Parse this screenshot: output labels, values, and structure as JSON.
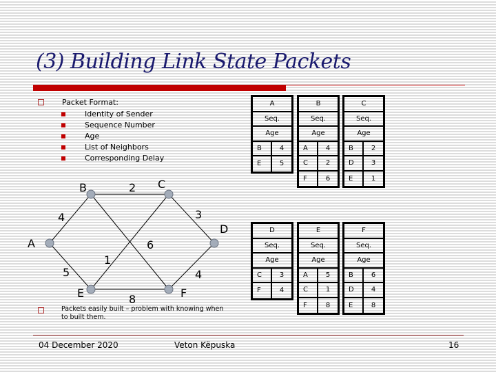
{
  "slide": {
    "title": "(3) Building Link State Packets",
    "bullets": [
      {
        "text": "Packet Format:",
        "sub": [
          "Identity of Sender",
          "Sequence Number",
          "Age",
          "List of Neighbors",
          "Corresponding Delay"
        ]
      },
      {
        "text_line1": "Packets easily built – problem with knowing when",
        "text_line2": "to built them."
      }
    ],
    "footer": {
      "date": "04 December 2020",
      "author": "Veton Këpuska",
      "page": "16"
    },
    "colors": {
      "title": "#1a1a6e",
      "accent": "#c00000",
      "node_fill": "#a3acb9"
    }
  },
  "graph": {
    "nodes": [
      {
        "id": "A",
        "label": "A"
      },
      {
        "id": "B",
        "label": "B"
      },
      {
        "id": "C",
        "label": "C"
      },
      {
        "id": "D",
        "label": "D"
      },
      {
        "id": "E",
        "label": "E"
      },
      {
        "id": "F",
        "label": "F"
      }
    ],
    "edges": [
      {
        "from": "A",
        "to": "B",
        "weight": "4"
      },
      {
        "from": "A",
        "to": "E",
        "weight": "5"
      },
      {
        "from": "B",
        "to": "C",
        "weight": "2"
      },
      {
        "from": "B",
        "to": "F",
        "weight": "6"
      },
      {
        "from": "C",
        "to": "E",
        "weight": "1"
      },
      {
        "from": "C",
        "to": "D",
        "weight": "3"
      },
      {
        "from": "D",
        "to": "F",
        "weight": "4"
      },
      {
        "from": "E",
        "to": "F",
        "weight": "8"
      }
    ]
  },
  "packets": [
    {
      "router": "A",
      "seq": "Seq.",
      "age": "Age",
      "neighbors": [
        [
          "B",
          "4"
        ],
        [
          "E",
          "5"
        ]
      ]
    },
    {
      "router": "B",
      "seq": "Seq.",
      "age": "Age",
      "neighbors": [
        [
          "A",
          "4"
        ],
        [
          "C",
          "2"
        ],
        [
          "F",
          "6"
        ]
      ]
    },
    {
      "router": "C",
      "seq": "Seq.",
      "age": "Age",
      "neighbors": [
        [
          "B",
          "2"
        ],
        [
          "D",
          "3"
        ],
        [
          "E",
          "1"
        ]
      ]
    },
    {
      "router": "D",
      "seq": "Seq.",
      "age": "Age",
      "neighbors": [
        [
          "C",
          "3"
        ],
        [
          "F",
          "4"
        ]
      ]
    },
    {
      "router": "E",
      "seq": "Seq.",
      "age": "Age",
      "neighbors": [
        [
          "A",
          "5"
        ],
        [
          "C",
          "1"
        ],
        [
          "F",
          "8"
        ]
      ]
    },
    {
      "router": "F",
      "seq": "Seq.",
      "age": "Age",
      "neighbors": [
        [
          "B",
          "6"
        ],
        [
          "D",
          "4"
        ],
        [
          "E",
          "8"
        ]
      ]
    }
  ]
}
